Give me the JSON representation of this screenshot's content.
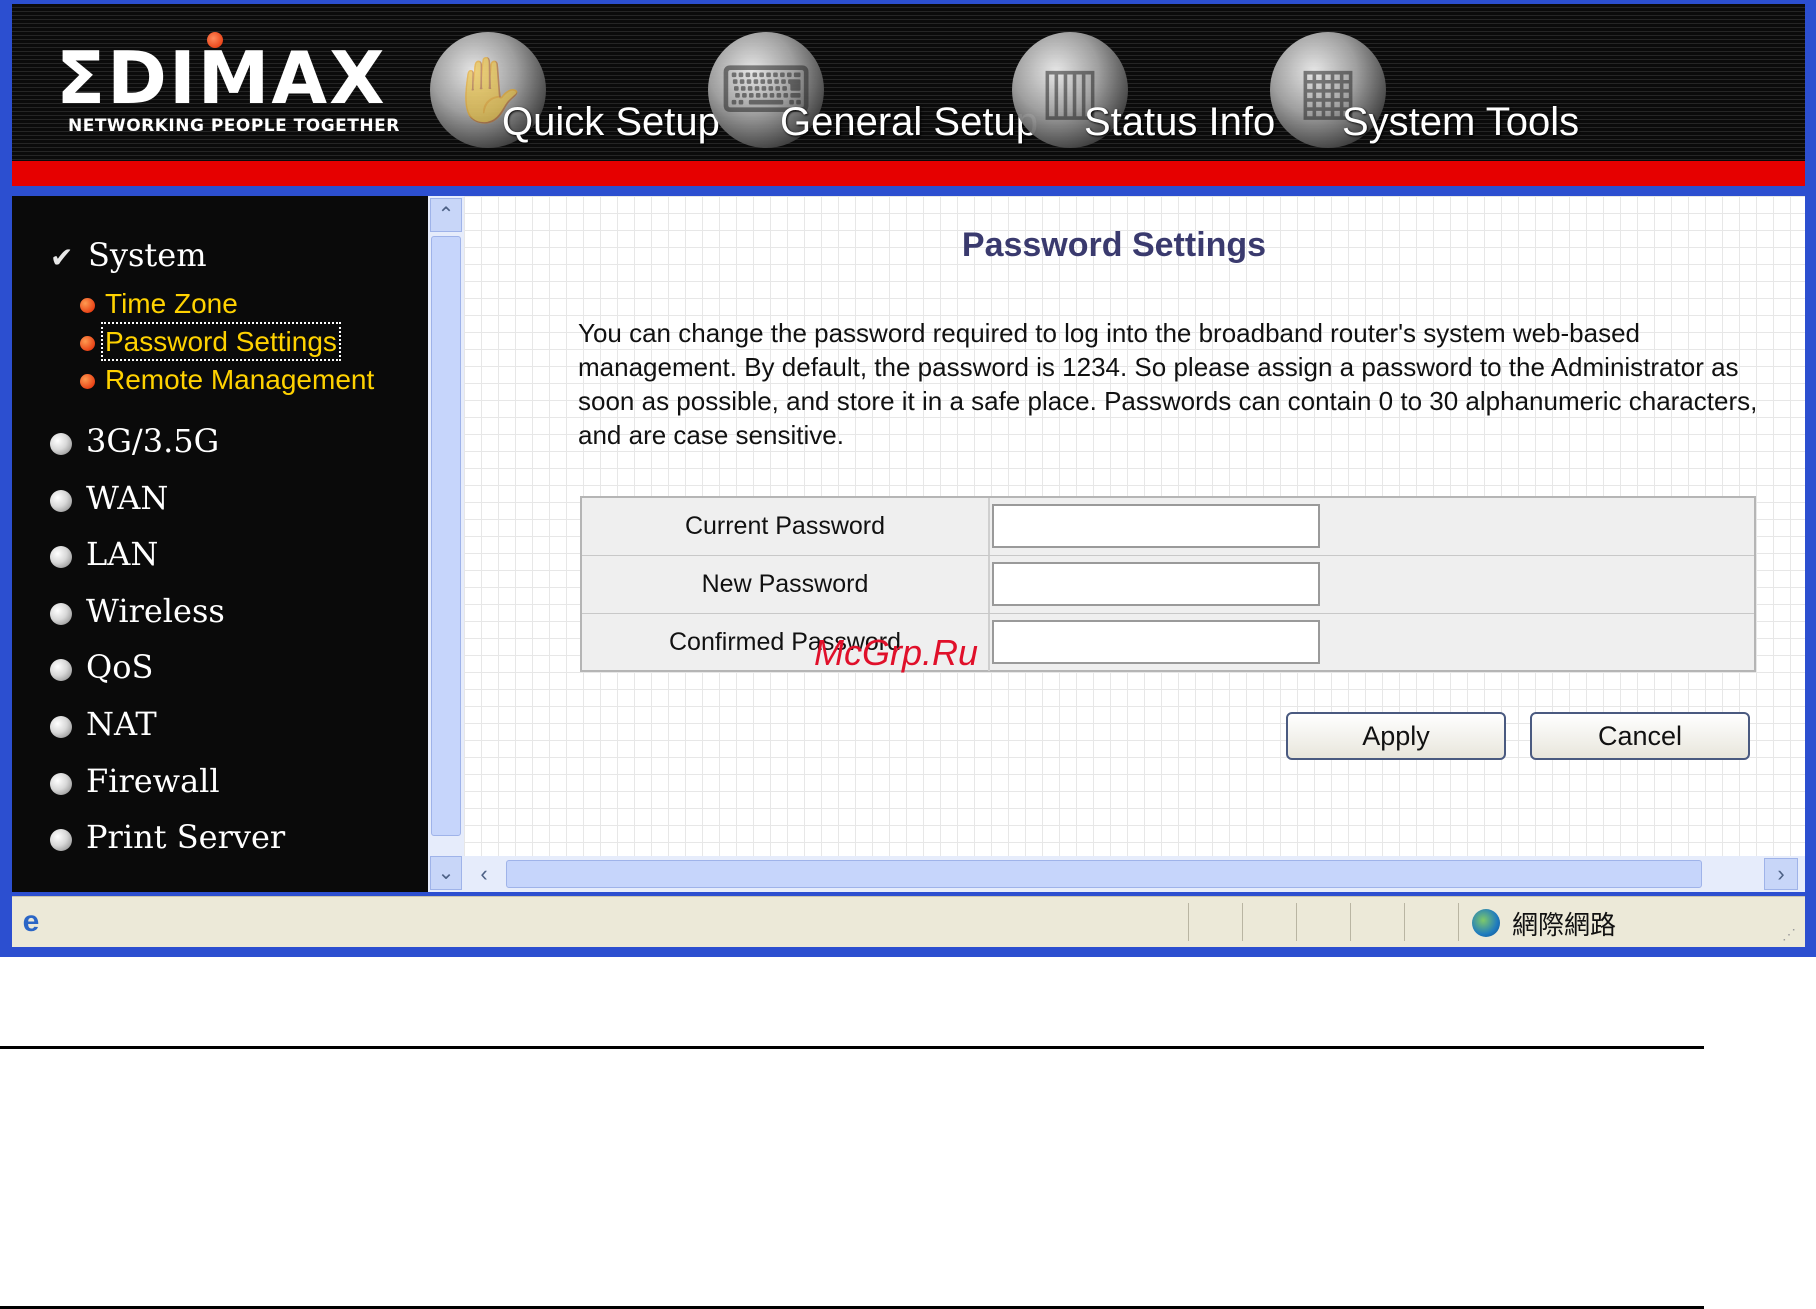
{
  "brand": {
    "logo": "ΣDIMAX",
    "tagline": "NETWORKING PEOPLE TOGETHER",
    "accent_red": "#e60000",
    "frame_blue": "#2c4fd0"
  },
  "top_nav": [
    {
      "label": "Quick Setup",
      "icon": "hand-orb-icon"
    },
    {
      "label": "General Setup",
      "icon": "keyboard-orb-icon"
    },
    {
      "label": "Status Info",
      "icon": "chart-orb-icon"
    },
    {
      "label": "System Tools",
      "icon": "circuit-orb-icon"
    }
  ],
  "sidebar": {
    "system": {
      "label": "System",
      "icon": "checkmark-icon"
    },
    "system_sub": [
      {
        "label": "Time Zone"
      },
      {
        "label": "Password Settings",
        "selected": true
      },
      {
        "label": "Remote Management"
      }
    ],
    "items": [
      {
        "label": "3G/3.5G"
      },
      {
        "label": "WAN"
      },
      {
        "label": "LAN"
      },
      {
        "label": "Wireless"
      },
      {
        "label": "QoS"
      },
      {
        "label": "NAT"
      },
      {
        "label": "Firewall"
      },
      {
        "label": "Print Server"
      }
    ]
  },
  "main": {
    "title": "Password Settings",
    "description": "You can change the password required to log into the broadband router's system web-based management. By default, the password is 1234. So please assign a password to the Administrator as soon as possible, and store it in a safe place. Passwords can contain 0 to 30 alphanumeric characters, and are case sensitive.",
    "fields": [
      {
        "label": "Current Password",
        "value": ""
      },
      {
        "label": "New Password",
        "value": ""
      },
      {
        "label": "Confirmed Password",
        "value": ""
      }
    ],
    "apply_label": "Apply",
    "cancel_label": "Cancel"
  },
  "statusbar": {
    "zone": "網際網路"
  },
  "watermark": "McGrp.Ru"
}
